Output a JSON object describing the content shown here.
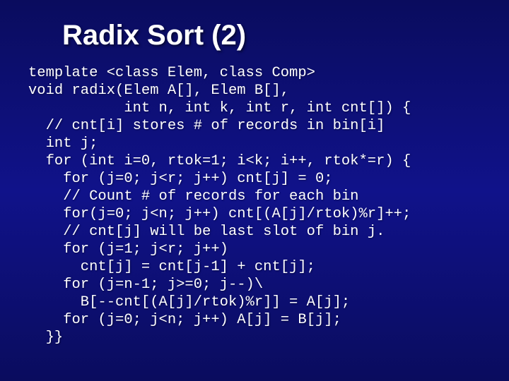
{
  "title": "Radix Sort (2)",
  "code_lines": [
    "template <class Elem, class Comp>",
    "void radix(Elem A[], Elem B[],",
    "           int n, int k, int r, int cnt[]) {",
    "  // cnt[i] stores # of records in bin[i]",
    "  int j;",
    "  for (int i=0, rtok=1; i<k; i++, rtok*=r) {",
    "    for (j=0; j<r; j++) cnt[j] = 0;",
    "    // Count # of records for each bin",
    "    for(j=0; j<n; j++) cnt[(A[j]/rtok)%r]++;",
    "    // cnt[j] will be last slot of bin j.",
    "    for (j=1; j<r; j++)",
    "      cnt[j] = cnt[j-1] + cnt[j];",
    "    for (j=n-1; j>=0; j--)\\",
    "      B[--cnt[(A[j]/rtok)%r]] = A[j];",
    "    for (j=0; j<n; j++) A[j] = B[j];",
    "  }}"
  ]
}
